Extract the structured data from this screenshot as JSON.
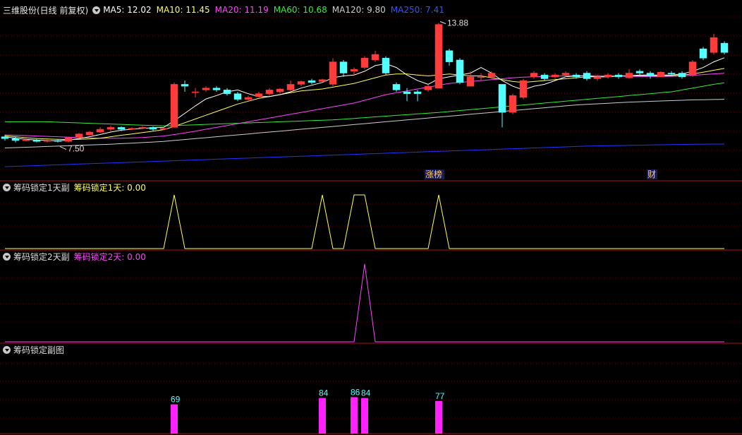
{
  "main": {
    "stock_name": "三维股份(日线 前复权)",
    "ma_labels": [
      {
        "text": "MA5: 12.02",
        "color": "#ffffff"
      },
      {
        "text": "MA10: 11.45",
        "color": "#ffff55"
      },
      {
        "text": "MA20: 11.19",
        "color": "#ff44ff"
      },
      {
        "text": "MA60: 10.68",
        "color": "#33ee33"
      },
      {
        "text": "MA120: 9.80",
        "color": "#cccccc"
      },
      {
        "text": "MA250: 7.41",
        "color": "#3355ff"
      }
    ],
    "high_annotation": "13.88",
    "low_annotation": "7.50",
    "event_labels": [
      {
        "text": "涨榜",
        "index": 40
      },
      {
        "text": "财",
        "index": 61
      }
    ]
  },
  "panel1": {
    "title": "筹码锁定1天副",
    "indicator": "筹码锁定1天: 0.00",
    "color": "#ffff55"
  },
  "panel2": {
    "title": "筹码锁定2天副",
    "indicator": "筹码锁定2天: 0.00",
    "color": "#ff44ff"
  },
  "panel3": {
    "title": "筹码锁定副图",
    "bar_color": "#ff22ff"
  },
  "chart_data": {
    "type": "candlestick",
    "candles": [
      [
        7.8,
        7.7,
        7.9,
        7.6
      ],
      [
        7.7,
        7.6,
        7.8,
        7.5
      ],
      [
        7.6,
        7.62,
        7.7,
        7.55
      ],
      [
        7.62,
        7.55,
        7.7,
        7.5
      ],
      [
        7.55,
        7.6,
        7.65,
        7.5
      ],
      [
        7.6,
        7.55,
        7.65,
        7.5
      ],
      [
        7.55,
        7.75,
        7.8,
        7.5
      ],
      [
        7.75,
        7.95,
        8.0,
        7.7
      ],
      [
        7.9,
        8.05,
        8.1,
        7.85
      ],
      [
        8.05,
        8.2,
        8.3,
        8.0
      ],
      [
        8.2,
        8.3,
        8.4,
        8.1
      ],
      [
        8.3,
        8.2,
        8.35,
        8.1
      ],
      [
        8.2,
        8.25,
        8.3,
        8.15
      ],
      [
        8.25,
        8.3,
        8.35,
        8.2
      ],
      [
        8.3,
        8.2,
        8.35,
        8.1
      ],
      [
        8.2,
        8.25,
        8.3,
        8.15
      ],
      [
        8.3,
        10.6,
        10.7,
        8.3
      ],
      [
        10.6,
        10.5,
        10.8,
        10.2
      ],
      [
        10.2,
        10.2,
        10.4,
        9.9
      ],
      [
        10.3,
        10.4,
        10.5,
        10.2
      ],
      [
        10.4,
        10.3,
        10.5,
        10.2
      ],
      [
        10.3,
        10.1,
        10.4,
        10.0
      ],
      [
        10.1,
        9.8,
        10.2,
        9.7
      ],
      [
        9.8,
        9.9,
        10.0,
        9.7
      ],
      [
        9.95,
        10.1,
        10.2,
        9.9
      ],
      [
        10.1,
        10.3,
        10.4,
        10.0
      ],
      [
        10.2,
        10.35,
        10.4,
        10.1
      ],
      [
        10.3,
        10.6,
        10.8,
        10.2
      ],
      [
        10.6,
        10.75,
        10.8,
        10.5
      ],
      [
        10.8,
        10.7,
        10.9,
        10.6
      ],
      [
        10.75,
        10.85,
        10.9,
        10.7
      ],
      [
        10.6,
        11.8,
        12.0,
        10.5
      ],
      [
        11.8,
        11.2,
        11.9,
        11.0
      ],
      [
        11.3,
        11.4,
        11.5,
        11.1
      ],
      [
        11.5,
        12.0,
        12.1,
        11.4
      ],
      [
        11.9,
        12.2,
        12.4,
        11.8
      ],
      [
        12.0,
        11.2,
        12.1,
        11.1
      ],
      [
        10.6,
        10.3,
        10.7,
        10.2
      ],
      [
        10.2,
        10.1,
        10.4,
        9.7
      ],
      [
        10.2,
        10.1,
        10.3,
        9.7
      ],
      [
        10.3,
        10.5,
        10.6,
        10.2
      ],
      [
        10.4,
        13.8,
        13.88,
        10.4
      ],
      [
        12.4,
        11.8,
        12.5,
        11.6
      ],
      [
        11.9,
        10.7,
        12.0,
        10.6
      ],
      [
        10.5,
        11.0,
        11.3,
        10.5
      ],
      [
        11.0,
        11.0,
        11.2,
        10.8
      ],
      [
        11.0,
        11.2,
        11.3,
        10.9
      ],
      [
        10.6,
        9.1,
        10.6,
        8.3
      ],
      [
        9.1,
        10.0,
        10.1,
        9.0
      ],
      [
        9.9,
        10.8,
        10.9,
        9.8
      ],
      [
        11.0,
        11.2,
        11.3,
        10.9
      ],
      [
        11.1,
        10.9,
        11.2,
        10.8
      ],
      [
        11.0,
        11.1,
        11.2,
        10.9
      ],
      [
        11.1,
        11.2,
        11.3,
        11.0
      ],
      [
        11.1,
        11.0,
        11.2,
        10.9
      ],
      [
        11.2,
        10.9,
        11.3,
        10.8
      ],
      [
        10.9,
        11.0,
        11.1,
        10.8
      ],
      [
        11.0,
        11.1,
        11.2,
        10.9
      ],
      [
        11.1,
        11.0,
        11.2,
        10.9
      ],
      [
        10.95,
        11.2,
        11.4,
        10.9
      ],
      [
        11.3,
        11.2,
        11.4,
        11.1
      ],
      [
        11.2,
        11.05,
        11.3,
        10.9
      ],
      [
        11.0,
        11.25,
        11.3,
        11.0
      ],
      [
        11.2,
        11.15,
        11.3,
        11.1
      ],
      [
        11.2,
        11.0,
        11.3,
        10.9
      ],
      [
        11.1,
        11.8,
        11.9,
        11.0
      ],
      [
        12.5,
        12.0,
        12.6,
        11.9
      ],
      [
        12.3,
        13.1,
        13.3,
        12.2
      ],
      [
        12.8,
        12.3,
        12.9,
        12.2
      ]
    ],
    "ma5": [
      7.8,
      7.72,
      7.66,
      7.62,
      7.6,
      7.58,
      7.62,
      7.7,
      7.8,
      7.92,
      8.05,
      8.15,
      8.2,
      8.25,
      8.28,
      8.3,
      8.65,
      9.05,
      9.45,
      9.82,
      10.0,
      10.2,
      10.3,
      10.1,
      9.95,
      9.95,
      10.05,
      10.2,
      10.4,
      10.55,
      10.7,
      10.95,
      11.05,
      11.1,
      11.3,
      11.6,
      11.7,
      11.5,
      11.1,
      10.8,
      10.6,
      10.9,
      11.0,
      11.1,
      11.2,
      11.5,
      11.2,
      10.8,
      10.5,
      10.3,
      10.5,
      10.6,
      10.8,
      11.0,
      11.05,
      11.05,
      11.0,
      11.0,
      11.05,
      11.05,
      11.1,
      11.1,
      11.1,
      11.1,
      11.15,
      11.3,
      11.5,
      11.8,
      12.02
    ],
    "ma10": [
      7.85,
      7.8,
      7.75,
      7.7,
      7.68,
      7.66,
      7.65,
      7.66,
      7.68,
      7.72,
      7.8,
      7.88,
      7.95,
      8.02,
      8.1,
      8.18,
      8.35,
      8.55,
      8.75,
      8.95,
      9.15,
      9.35,
      9.55,
      9.7,
      9.85,
      9.95,
      10.05,
      10.15,
      10.25,
      10.3,
      10.35,
      10.45,
      10.55,
      10.65,
      10.8,
      10.95,
      11.1,
      11.15,
      11.15,
      11.1,
      11.05,
      11.1,
      11.15,
      11.1,
      11.05,
      11.05,
      10.95,
      10.85,
      10.75,
      10.7,
      10.75,
      10.8,
      10.85,
      10.9,
      10.95,
      11.0,
      11.0,
      11.0,
      11.05,
      11.05,
      11.05,
      11.05,
      11.05,
      11.05,
      11.1,
      11.15,
      11.25,
      11.35,
      11.45
    ],
    "ma20": [
      7.9,
      7.88,
      7.86,
      7.84,
      7.82,
      7.8,
      7.78,
      7.76,
      7.74,
      7.72,
      7.72,
      7.72,
      7.74,
      7.76,
      7.8,
      7.84,
      7.92,
      8.0,
      8.1,
      8.2,
      8.3,
      8.4,
      8.5,
      8.6,
      8.7,
      8.8,
      8.9,
      9.0,
      9.1,
      9.2,
      9.3,
      9.4,
      9.5,
      9.6,
      9.75,
      9.9,
      10.05,
      10.15,
      10.25,
      10.35,
      10.45,
      10.55,
      10.65,
      10.7,
      10.75,
      10.8,
      10.85,
      10.9,
      10.95,
      10.98,
      11.0,
      11.02,
      11.04,
      11.05,
      11.06,
      11.06,
      11.06,
      11.05,
      11.04,
      11.03,
      11.02,
      11.02,
      11.02,
      11.03,
      11.05,
      11.08,
      11.12,
      11.16,
      11.19
    ],
    "ma60": [
      8.6,
      8.6,
      8.6,
      8.6,
      8.6,
      8.58,
      8.56,
      8.54,
      8.52,
      8.5,
      8.48,
      8.46,
      8.44,
      8.42,
      8.4,
      8.38,
      8.4,
      8.42,
      8.44,
      8.46,
      8.48,
      8.5,
      8.52,
      8.54,
      8.56,
      8.58,
      8.6,
      8.62,
      8.64,
      8.66,
      8.68,
      8.7,
      8.74,
      8.78,
      8.82,
      8.86,
      8.9,
      8.94,
      8.98,
      9.02,
      9.06,
      9.1,
      9.15,
      9.2,
      9.25,
      9.3,
      9.35,
      9.4,
      9.45,
      9.5,
      9.55,
      9.6,
      9.65,
      9.7,
      9.75,
      9.8,
      9.85,
      9.9,
      9.95,
      10.0,
      10.05,
      10.1,
      10.15,
      10.2,
      10.3,
      10.4,
      10.5,
      10.6,
      10.68
    ],
    "ma120": [
      7.2,
      7.22,
      7.24,
      7.26,
      7.28,
      7.3,
      7.32,
      7.34,
      7.36,
      7.38,
      7.4,
      7.43,
      7.46,
      7.49,
      7.52,
      7.55,
      7.6,
      7.65,
      7.7,
      7.75,
      7.8,
      7.85,
      7.9,
      7.95,
      8.0,
      8.05,
      8.1,
      8.15,
      8.2,
      8.25,
      8.3,
      8.35,
      8.4,
      8.45,
      8.5,
      8.55,
      8.6,
      8.65,
      8.7,
      8.75,
      8.8,
      8.85,
      8.9,
      8.95,
      9.0,
      9.05,
      9.1,
      9.15,
      9.2,
      9.25,
      9.3,
      9.35,
      9.4,
      9.45,
      9.5,
      9.53,
      9.56,
      9.59,
      9.62,
      9.65,
      9.67,
      9.69,
      9.71,
      9.73,
      9.75,
      9.77,
      9.78,
      9.79,
      9.8
    ],
    "ma250": [
      6.2,
      6.22,
      6.24,
      6.26,
      6.28,
      6.3,
      6.32,
      6.34,
      6.36,
      6.38,
      6.4,
      6.42,
      6.44,
      6.46,
      6.48,
      6.5,
      6.52,
      6.54,
      6.56,
      6.58,
      6.6,
      6.62,
      6.64,
      6.66,
      6.68,
      6.7,
      6.72,
      6.74,
      6.76,
      6.78,
      6.8,
      6.82,
      6.84,
      6.86,
      6.88,
      6.9,
      6.92,
      6.94,
      6.96,
      6.98,
      7.0,
      7.02,
      7.04,
      7.06,
      7.08,
      7.1,
      7.12,
      7.14,
      7.16,
      7.18,
      7.2,
      7.22,
      7.24,
      7.26,
      7.28,
      7.3,
      7.31,
      7.32,
      7.33,
      7.34,
      7.35,
      7.36,
      7.37,
      7.38,
      7.39,
      7.4,
      7.405,
      7.41,
      7.41
    ],
    "panel1_values": [
      0,
      0,
      0,
      0,
      0,
      0,
      0,
      0,
      0,
      0,
      0,
      0,
      0,
      0,
      0,
      0,
      1,
      0,
      0,
      0,
      0,
      0,
      0,
      0,
      0,
      0,
      0,
      0,
      0,
      0,
      1,
      0,
      0,
      1,
      1,
      0,
      0,
      0,
      0,
      0,
      0,
      1,
      0,
      0,
      0,
      0,
      0,
      0,
      0,
      0,
      0,
      0,
      0,
      0,
      0,
      0,
      0,
      0,
      0,
      0,
      0,
      0,
      0,
      0,
      0,
      0,
      0,
      0,
      0
    ],
    "panel2_values": [
      0,
      0,
      0,
      0,
      0,
      0,
      0,
      0,
      0,
      0,
      0,
      0,
      0,
      0,
      0,
      0,
      0,
      0,
      0,
      0,
      0,
      0,
      0,
      0,
      0,
      0,
      0,
      0,
      0,
      0,
      0,
      0,
      0,
      0,
      1,
      0,
      0,
      0,
      0,
      0,
      0,
      0,
      0,
      0,
      0,
      0,
      0,
      0,
      0,
      0,
      0,
      0,
      0,
      0,
      0,
      0,
      0,
      0,
      0,
      0,
      0,
      0,
      0,
      0,
      0,
      0,
      0,
      0,
      0
    ],
    "panel3_bars": [
      {
        "index": 16,
        "value": 69
      },
      {
        "index": 30,
        "value": 84
      },
      {
        "index": 33,
        "value": 86
      },
      {
        "index": 34,
        "value": 84
      },
      {
        "index": 41,
        "value": 77
      }
    ]
  }
}
